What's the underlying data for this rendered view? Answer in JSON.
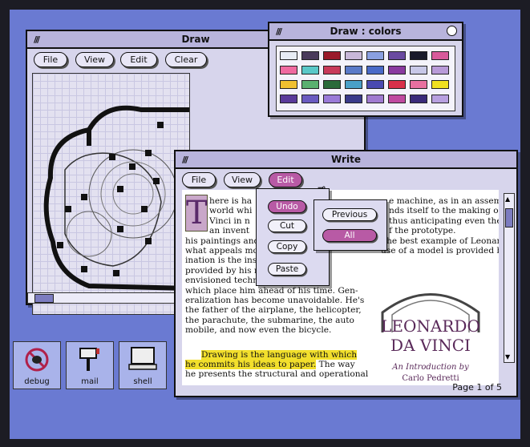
{
  "draw": {
    "title": "Draw",
    "menu": [
      "File",
      "View",
      "Edit",
      "Clear"
    ]
  },
  "colors": {
    "title": "Draw : colors",
    "swatches": [
      [
        "#e8ecf4",
        "#4a3a5a",
        "#9a1a2a",
        "#c8b8d8",
        "#8aa0e0",
        "#6a4aa0",
        "#1a1a2a",
        "#d85a9a"
      ],
      [
        "#f06aa0",
        "#5ac8c8",
        "#c83a5a",
        "#5a7ac8",
        "#4a6ac8",
        "#8a3aa0",
        "#c8c8e8",
        "#b89ad8"
      ],
      [
        "#f0c030",
        "#5ab070",
        "#2a6a3a",
        "#4aa0c8",
        "#4a4ab0",
        "#d8304a",
        "#e870a0",
        "#f0e020"
      ],
      [
        "#5a3a9a",
        "#6a5ac0",
        "#9a7ad8",
        "#3a3a8a",
        "#a07ad0",
        "#c04aa0",
        "#3a2a7a",
        "#b8a0e0"
      ]
    ]
  },
  "write": {
    "title": "Write",
    "menu": [
      "File",
      "View",
      "Edit"
    ],
    "edit_menu": [
      "Undo",
      "Cut",
      "Copy",
      "Paste"
    ],
    "undo_submenu": [
      "Previous",
      "All"
    ],
    "dropcap": "T",
    "lines": [
      "here is ha",
      "world whi",
      "Vinci in n",
      "an invent",
      "his paintings and",
      "what appeals mos",
      "ination is the insi",
      "provided by his n",
      "envisioned techno",
      "which place him ahead of his time. Gen-",
      "eralization has become unavoidable. He's",
      "the father of the airplane, the helicopter,",
      "the parachute, the submarine, the auto",
      "mobile, and now even the bicycle."
    ],
    "right_lines": [
      "e machine, as in an assem-",
      "nds itself to the making of",
      "thus anticipating even the",
      "f the prototype.",
      "The best example of Leonardo's",
      "use of a model is provided by his"
    ],
    "highlight_lines": [
      "Drawing is the language with which",
      "he commits his ideas to paper."
    ],
    "after_highlight": " The way",
    "last_line": "he presents the structural and operational",
    "book_title_1": "LEONARDO",
    "book_title_2": "DA VINCI",
    "book_subtitle": "An Introduction by",
    "book_author": "Carlo Pedretti",
    "status": "Page 1 of 5"
  },
  "dock": [
    {
      "label": "debug",
      "icon": "bug-icon"
    },
    {
      "label": "mail",
      "icon": "mailbox-icon"
    },
    {
      "label": "shell",
      "icon": "terminal-icon"
    }
  ]
}
